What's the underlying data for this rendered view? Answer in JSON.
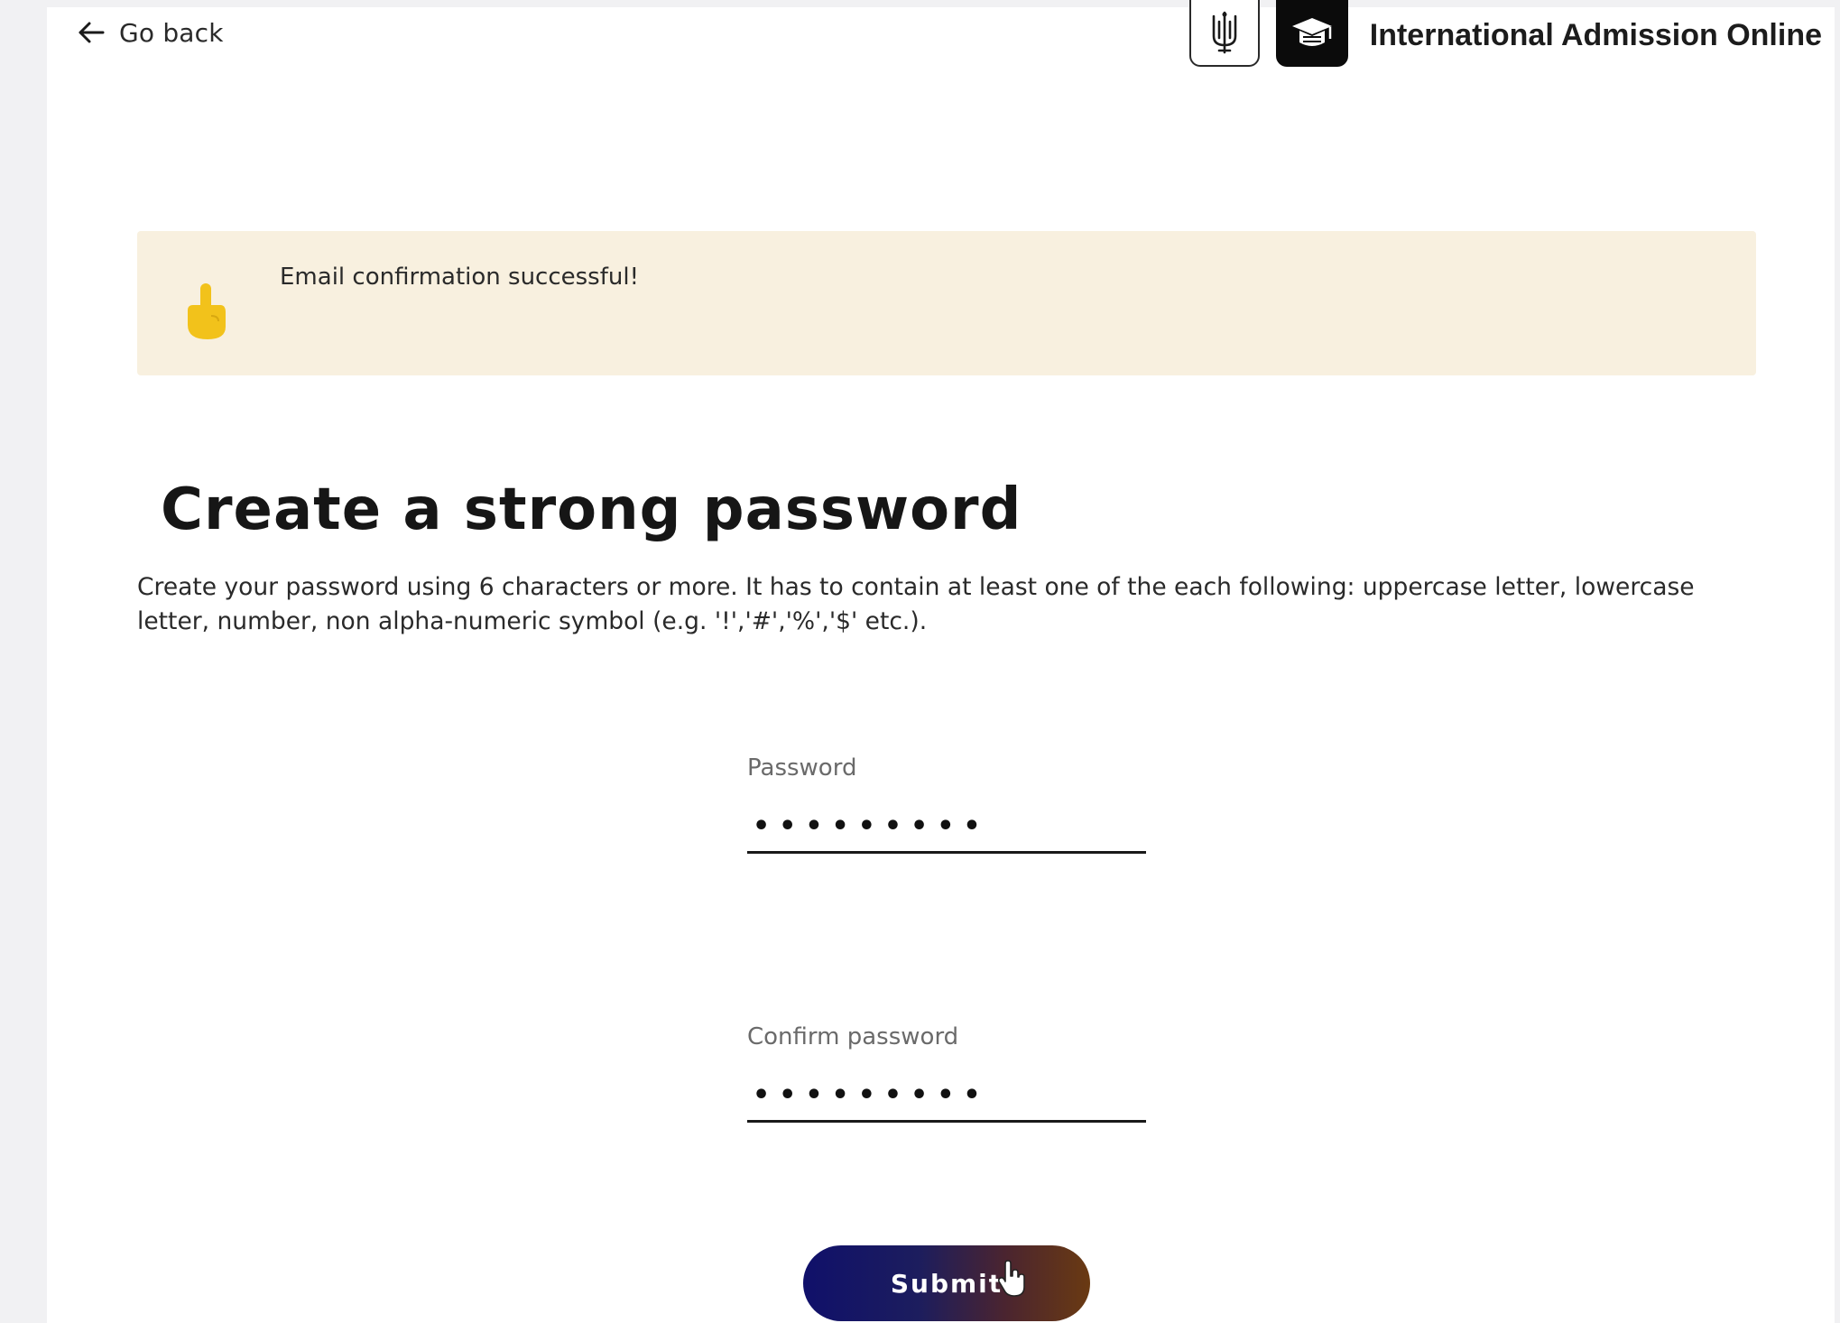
{
  "header": {
    "go_back_label": "Go back",
    "brand_title": "International Admission Online",
    "emblem_icon": "trident-emblem-icon",
    "logo_icon": "graduation-cap-icon"
  },
  "notice": {
    "icon": "pointing-hand-icon",
    "message": "Email confirmation successful!",
    "background": "#f8f0df",
    "icon_color": "#f2c21b"
  },
  "main": {
    "title": "Create a strong password",
    "description": "Create your password using 6 characters or more. It has to contain at least one of the each following: uppercase letter, lowercase letter, number, non alpha-numeric symbol (e.g. '!','#','%','$' etc.)."
  },
  "form": {
    "password_label": "Password",
    "password_value": "•••••••••",
    "confirm_label": "Confirm password",
    "confirm_value": "•••••••••",
    "submit_label": "Submit"
  },
  "colors": {
    "submit_gradient_start": "#10106a",
    "submit_gradient_end": "#6a3a12",
    "gutter": "#f1f1f3"
  }
}
